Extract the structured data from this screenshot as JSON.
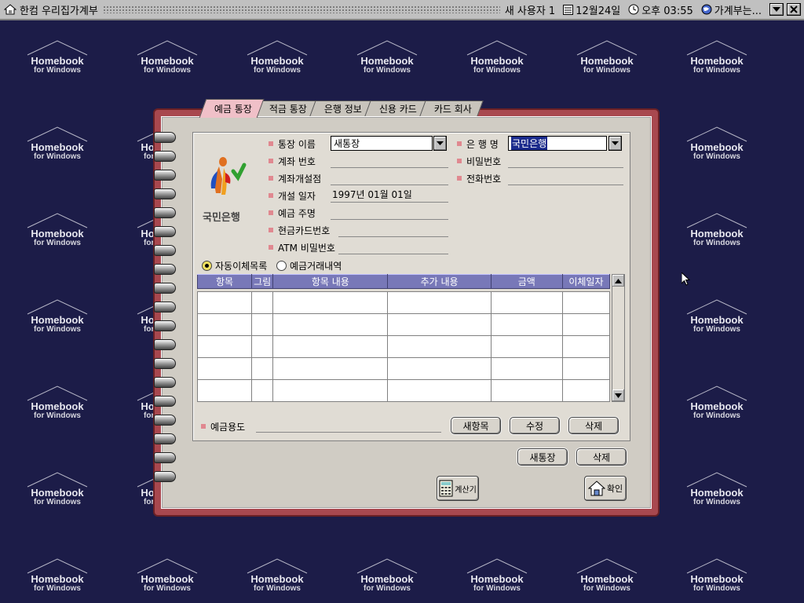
{
  "titlebar": {
    "title": "한컴 우리집가계부",
    "user": "새 사용자 1",
    "date": "12월24일",
    "time": "오후 03:55",
    "status": "가계부는..."
  },
  "background": {
    "brand": "Homebook",
    "sub": "for Windows"
  },
  "tabs": [
    "예금 통장",
    "적금 통장",
    "은행 정보",
    "신용 카드",
    "카드 회사"
  ],
  "bank_logo_text": "국민은행",
  "fields": {
    "account_name_label": "통장 이름",
    "account_name_value": "새통장",
    "account_no_label": "계좌 번호",
    "branch_label": "계좌개설점",
    "open_date_label": "개설 일자",
    "open_date_value": "1997년 01월 01일",
    "owner_label": "예금 주명",
    "cashcard_label": "현금카드번호",
    "atm_pw_label": "ATM 비밀번호",
    "bank_name_label": "은 행 명",
    "bank_name_value": "국민은행",
    "password_label": "비밀번호",
    "phone_label": "전화번호"
  },
  "radios": {
    "auto_transfer": "자동이체목록",
    "transactions": "예금거래내역",
    "selected": "auto_transfer"
  },
  "table": {
    "columns": [
      "항목",
      "그림",
      "항목 내용",
      "추가 내용",
      "금액",
      "이체일자"
    ],
    "rows": [
      [
        "",
        "",
        "",
        "",
        "",
        ""
      ],
      [
        "",
        "",
        "",
        "",
        "",
        ""
      ],
      [
        "",
        "",
        "",
        "",
        "",
        ""
      ],
      [
        "",
        "",
        "",
        "",
        "",
        ""
      ],
      [
        "",
        "",
        "",
        "",
        "",
        ""
      ]
    ]
  },
  "purpose_label": "예금용도",
  "buttons": {
    "new_item": "새항목",
    "edit": "수정",
    "delete": "삭제",
    "new_account": "새통장",
    "delete_account": "삭제",
    "calculator": "계산기",
    "ok": "확인"
  },
  "colors": {
    "background": "#1c1c48",
    "binder": "#a8484f",
    "header": "#7878b8",
    "selection": "#1a2a8c"
  }
}
